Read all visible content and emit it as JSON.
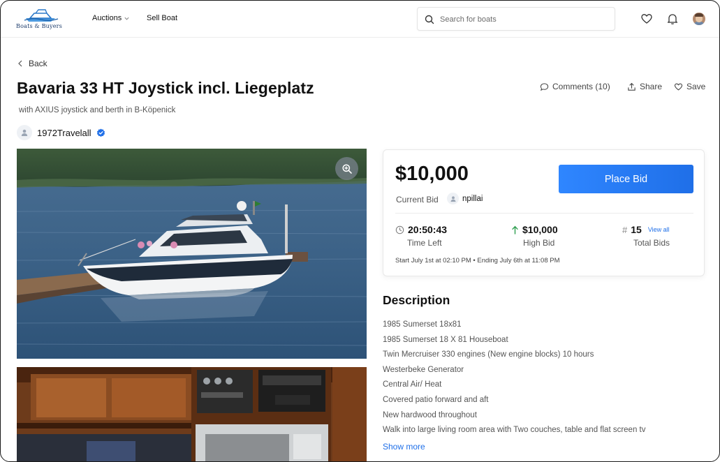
{
  "header": {
    "logo_text": "Boats & Buyers",
    "nav_auctions": "Auctions",
    "nav_sell": "Sell Boat",
    "search_placeholder": "Search for boats"
  },
  "listing": {
    "back_label": "Back",
    "title": "Bavaria 33 HT Joystick incl. Liegeplatz",
    "subtitle": "with AXIUS joystick and berth in B-Köpenick",
    "seller": "1972Travelall",
    "comments_label": "Comments (10)",
    "share_label": "Share",
    "save_label": "Save"
  },
  "bid": {
    "price": "$10,000",
    "current_bid_label": "Current Bid",
    "current_bidder": "npillai",
    "place_bid_label": "Place Bid",
    "time_left_value": "20:50:43",
    "time_left_label": "Time Left",
    "high_bid_value": "$10,000",
    "high_bid_label": "High Bid",
    "total_bids_value": "15",
    "view_all_label": "View all",
    "total_bids_label": "Total Bids",
    "dates": "Start July 1st at 02:10 PM  •  Ending July 6th at 11:08 PM"
  },
  "description": {
    "title": "Description",
    "lines": [
      "1985 Sumerset 18x81",
      "1985 Sumerset 18 X 81 Houseboat",
      "Twin Mercruiser 330 engines (New engine blocks) 10 hours",
      "Westerbeke Generator",
      "Central Air/ Heat",
      "Covered patio forward and aft",
      "New hardwood throughout",
      "Walk into large living room area with Two couches, table and flat screen tv"
    ],
    "show_more_label": "Show more"
  },
  "colors": {
    "accent": "#1f6fe8",
    "verified": "#1f6fe8",
    "high_bid_arrow": "#2e9e4f"
  }
}
